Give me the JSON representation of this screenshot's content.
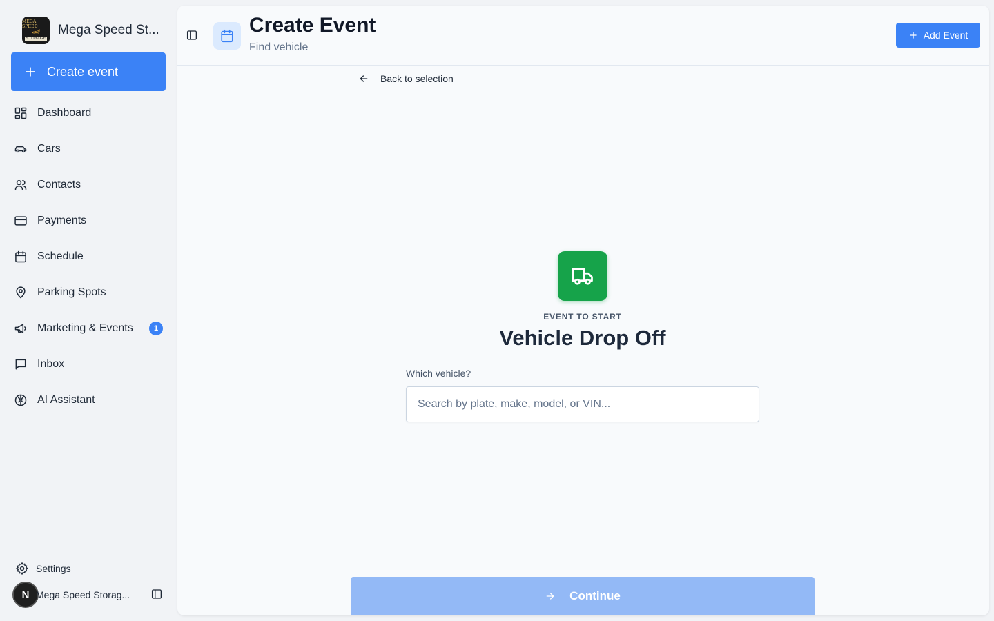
{
  "brand": {
    "name": "Mega Speed St...",
    "logo_lines": [
      "MEGA SPEED",
      "🏎",
      "STORAGE"
    ]
  },
  "sidebar": {
    "create_label": "Create event",
    "items": [
      {
        "label": "Dashboard",
        "icon": "dashboard-icon"
      },
      {
        "label": "Cars",
        "icon": "car-icon"
      },
      {
        "label": "Contacts",
        "icon": "users-icon"
      },
      {
        "label": "Payments",
        "icon": "credit-card-icon"
      },
      {
        "label": "Schedule",
        "icon": "calendar-icon"
      },
      {
        "label": "Parking Spots",
        "icon": "map-pin-icon"
      },
      {
        "label": "Marketing & Events",
        "icon": "megaphone-icon",
        "badge": "1"
      },
      {
        "label": "Inbox",
        "icon": "message-icon"
      },
      {
        "label": "AI Assistant",
        "icon": "brain-icon"
      }
    ],
    "settings_label": "Settings",
    "account": {
      "avatar_letter": "N",
      "name": "Mega Speed Storag..."
    }
  },
  "header": {
    "title": "Create Event",
    "subtitle": "Find vehicle",
    "add_event_label": "Add Event"
  },
  "main": {
    "back_label": "Back to selection",
    "eyebrow": "EVENT TO START",
    "event_name": "Vehicle Drop Off",
    "field_label": "Which vehicle?",
    "search_placeholder": "Search by plate, make, model, or VIN...",
    "search_value": "",
    "continue_label": "Continue"
  },
  "colors": {
    "accent": "#3b82f6",
    "event_icon_bg": "#16a34a",
    "continue_disabled": "#93b9f6"
  }
}
